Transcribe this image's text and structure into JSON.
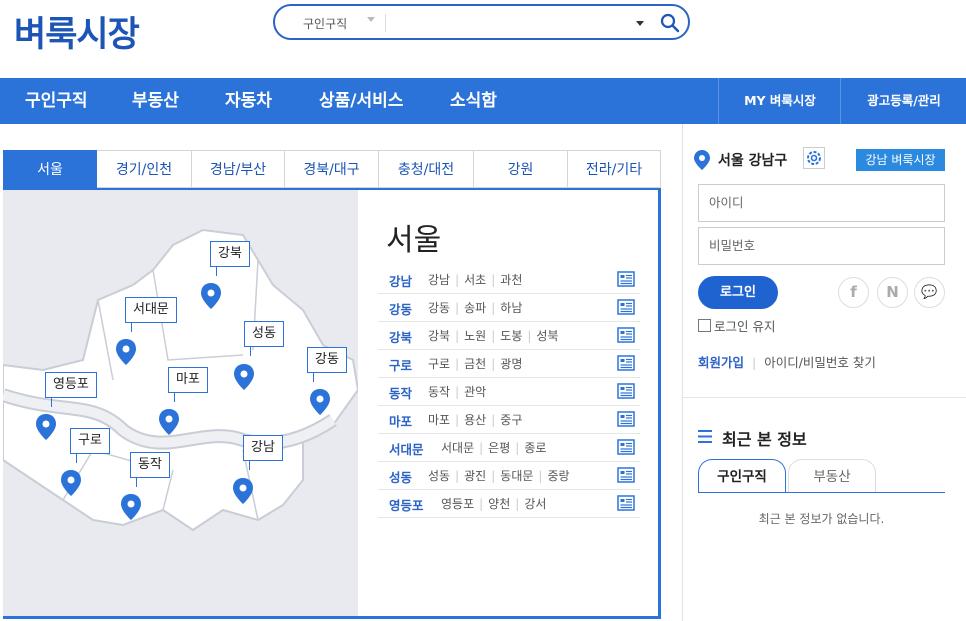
{
  "logo": "벼룩시장",
  "search": {
    "category": "구인구직",
    "placeholder": ""
  },
  "nav": {
    "items": [
      "구인구직",
      "부동산",
      "자동차",
      "상품/서비스",
      "소식함"
    ],
    "my": "MY 벼룩시장",
    "ad": "광고등록/관리"
  },
  "tabs": [
    "서울",
    "경기/인천",
    "경남/부산",
    "경북/대구",
    "충청/대전",
    "강원",
    "전라/기타"
  ],
  "map": {
    "pins": [
      "강북",
      "서대문",
      "성동",
      "강동",
      "영등포",
      "마포",
      "구로",
      "동작",
      "강남"
    ]
  },
  "region": {
    "title": "서울",
    "rows": [
      {
        "main": "강남",
        "subs": [
          "강남",
          "서초",
          "과천"
        ]
      },
      {
        "main": "강동",
        "subs": [
          "강동",
          "송파",
          "하남"
        ]
      },
      {
        "main": "강북",
        "subs": [
          "강북",
          "노원",
          "도봉",
          "성북"
        ]
      },
      {
        "main": "구로",
        "subs": [
          "구로",
          "금천",
          "광명"
        ]
      },
      {
        "main": "동작",
        "subs": [
          "동작",
          "관악"
        ]
      },
      {
        "main": "마포",
        "subs": [
          "마포",
          "용산",
          "중구"
        ]
      },
      {
        "main": "서대문",
        "subs": [
          "서대문",
          "은평",
          "종로"
        ]
      },
      {
        "main": "성동",
        "subs": [
          "성동",
          "광진",
          "동대문",
          "중랑"
        ]
      },
      {
        "main": "영등포",
        "subs": [
          "영등포",
          "양천",
          "강서"
        ]
      }
    ]
  },
  "sidebar": {
    "location": "서울 강남구",
    "market_btn": "강남 벼룩시장",
    "id_placeholder": "아이디",
    "pw_placeholder": "비밀번호",
    "login": "로그인",
    "keep_login": "로그인 유지",
    "join": "회원가입",
    "find": "아이디/비밀번호 찾기",
    "social": [
      "f",
      "N",
      "💬"
    ],
    "recent_title": "최근 본 정보",
    "recent_tabs": [
      "구인구직",
      "부동산"
    ],
    "recent_empty": "최근 본 정보가 없습니다."
  },
  "colors": {
    "brand": "#2b73d9",
    "logo": "#1c55b6"
  }
}
